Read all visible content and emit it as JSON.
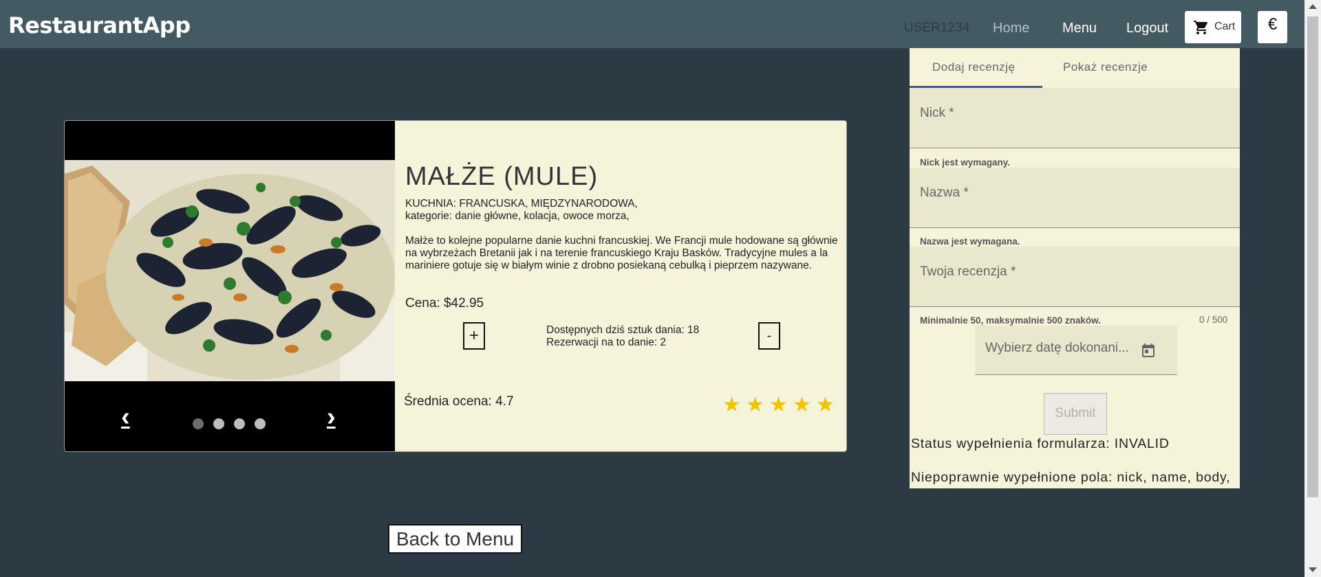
{
  "header": {
    "brand": "RestaurantApp",
    "user": "USER1234",
    "nav_home": "Home",
    "nav_menu": "Menu",
    "nav_logout": "Logout",
    "cart_label": "Cart",
    "currency_symbol": "€"
  },
  "dish": {
    "title": "MAŁŻE (MULE)",
    "cuisine": "KUCHNIA: FRANCUSKA, MIĘDZYNARODOWA,",
    "categories": "kategorie: danie główne, kolacja, owoce morza,",
    "description": "Małże to kolejne popularne danie kuchni francuskiej. We Francji mule hodowane są głównie na wybrzeżach Bretanii jak i na terenie francuskiego Kraju Basków. Tradycyjne mules a la mariniere gotuje się w białym winie z drobno posiekaną cebulką i pieprzem nazywane.",
    "price": "Cena: $42.95",
    "plus_label": "+",
    "minus_label": "-",
    "available_today": "Dostępnych dziś sztuk dania: 18",
    "reservations": "Rezerwacji na to danie: 2",
    "average_rating": "Średnia ocena: 4.7",
    "stars_filled": 5,
    "stars_total": 5,
    "star_glyph": "★",
    "carousel": {
      "prev": "‹",
      "next": "›",
      "slides": 4,
      "active_slide": 1
    }
  },
  "back_button": "Back to Menu",
  "review_form": {
    "tabs": [
      "Dodaj recenzję",
      "Pokaż recenzje"
    ],
    "active_tab": 0,
    "nick_label": "Nick *",
    "nick_error": "Nick jest wymagany.",
    "name_label": "Nazwa *",
    "name_error": "Nazwa jest wymagana.",
    "body_label": "Twoja recenzja *",
    "body_hint": "Minimalnie 50, maksymalnie 500 znaków.",
    "body_counter": "0 / 500",
    "date_placeholder": "Wybierz datę dokonani...",
    "submit": "Submit",
    "status": "Status wypełnienia formularza: INVALID",
    "invalid_fields": "Niepoprawnie wypełnione pola: nick, name, body,"
  },
  "colors": {
    "page_bg": "#2c3a43",
    "navbar_bg": "#445a63",
    "card_bg": "#f5f3da",
    "field_bg": "#e9e8cd",
    "star": "#f2c200",
    "tab_ink": "#3f51b5"
  },
  "icons": {
    "cart": "shopping-cart-icon",
    "calendar": "calendar-icon",
    "star": "star-icon"
  }
}
